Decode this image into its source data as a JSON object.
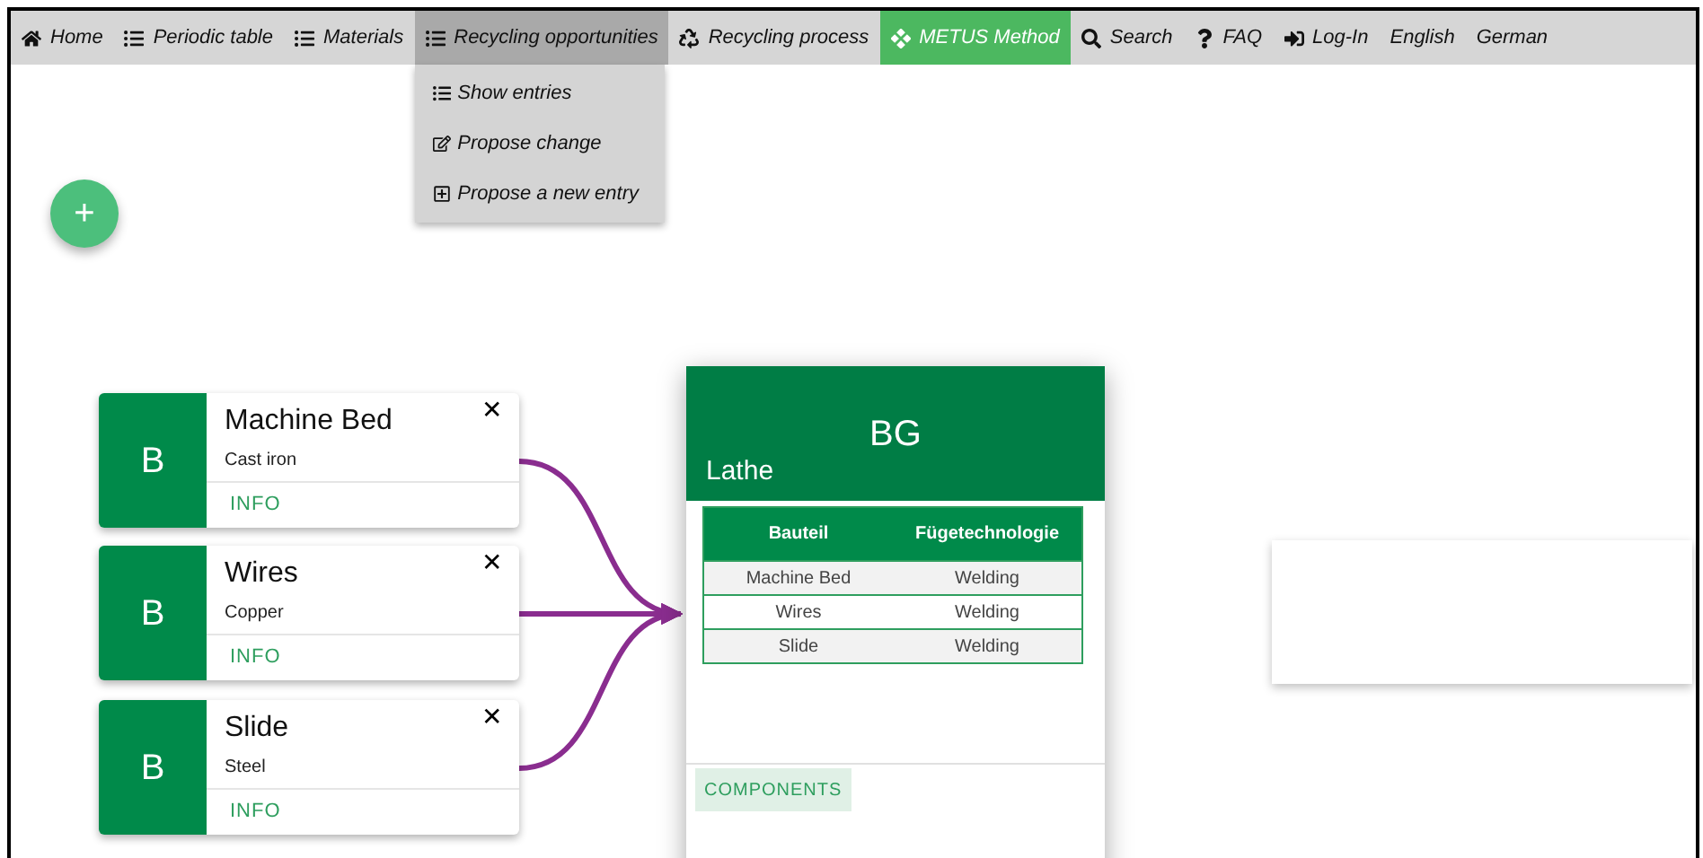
{
  "nav": {
    "items": [
      {
        "label": "Home",
        "selected": false,
        "expanded": false
      },
      {
        "label": "Periodic table",
        "selected": false,
        "expanded": false
      },
      {
        "label": "Materials",
        "selected": false,
        "expanded": false
      },
      {
        "label": "Recycling opportunities",
        "selected": false,
        "expanded": true
      },
      {
        "label": "Recycling process",
        "selected": false,
        "expanded": false
      },
      {
        "label": "METUS Method",
        "selected": true,
        "expanded": false
      },
      {
        "label": "Search",
        "selected": false,
        "expanded": false
      },
      {
        "label": "FAQ",
        "selected": false,
        "expanded": false
      },
      {
        "label": "Log-In",
        "selected": false,
        "expanded": false
      },
      {
        "label": "English",
        "selected": false,
        "expanded": false
      },
      {
        "label": "German",
        "selected": false,
        "expanded": false
      }
    ]
  },
  "dropdown": {
    "items": [
      "Show entries",
      "Propose change",
      "Propose a new entry"
    ]
  },
  "add_button": {
    "label": "+"
  },
  "components": [
    {
      "badge": "B",
      "name": "Machine Bed",
      "material": "Cast iron",
      "close": "✕",
      "link": "INFO"
    },
    {
      "badge": "B",
      "name": "Wires",
      "material": "Copper",
      "close": "✕",
      "link": "INFO"
    },
    {
      "badge": "B",
      "name": "Slide",
      "material": "Steel",
      "close": "✕",
      "link": "INFO"
    }
  ],
  "assembly": {
    "badge": "BG",
    "name": "Lathe",
    "table": {
      "columns": [
        "Bauteil",
        "Fügetechnologie"
      ],
      "rows": [
        [
          "Machine Bed",
          "Welding"
        ],
        [
          "Wires",
          "Welding"
        ],
        [
          "Slide",
          "Welding"
        ]
      ]
    },
    "button": "COMPONENTS"
  }
}
